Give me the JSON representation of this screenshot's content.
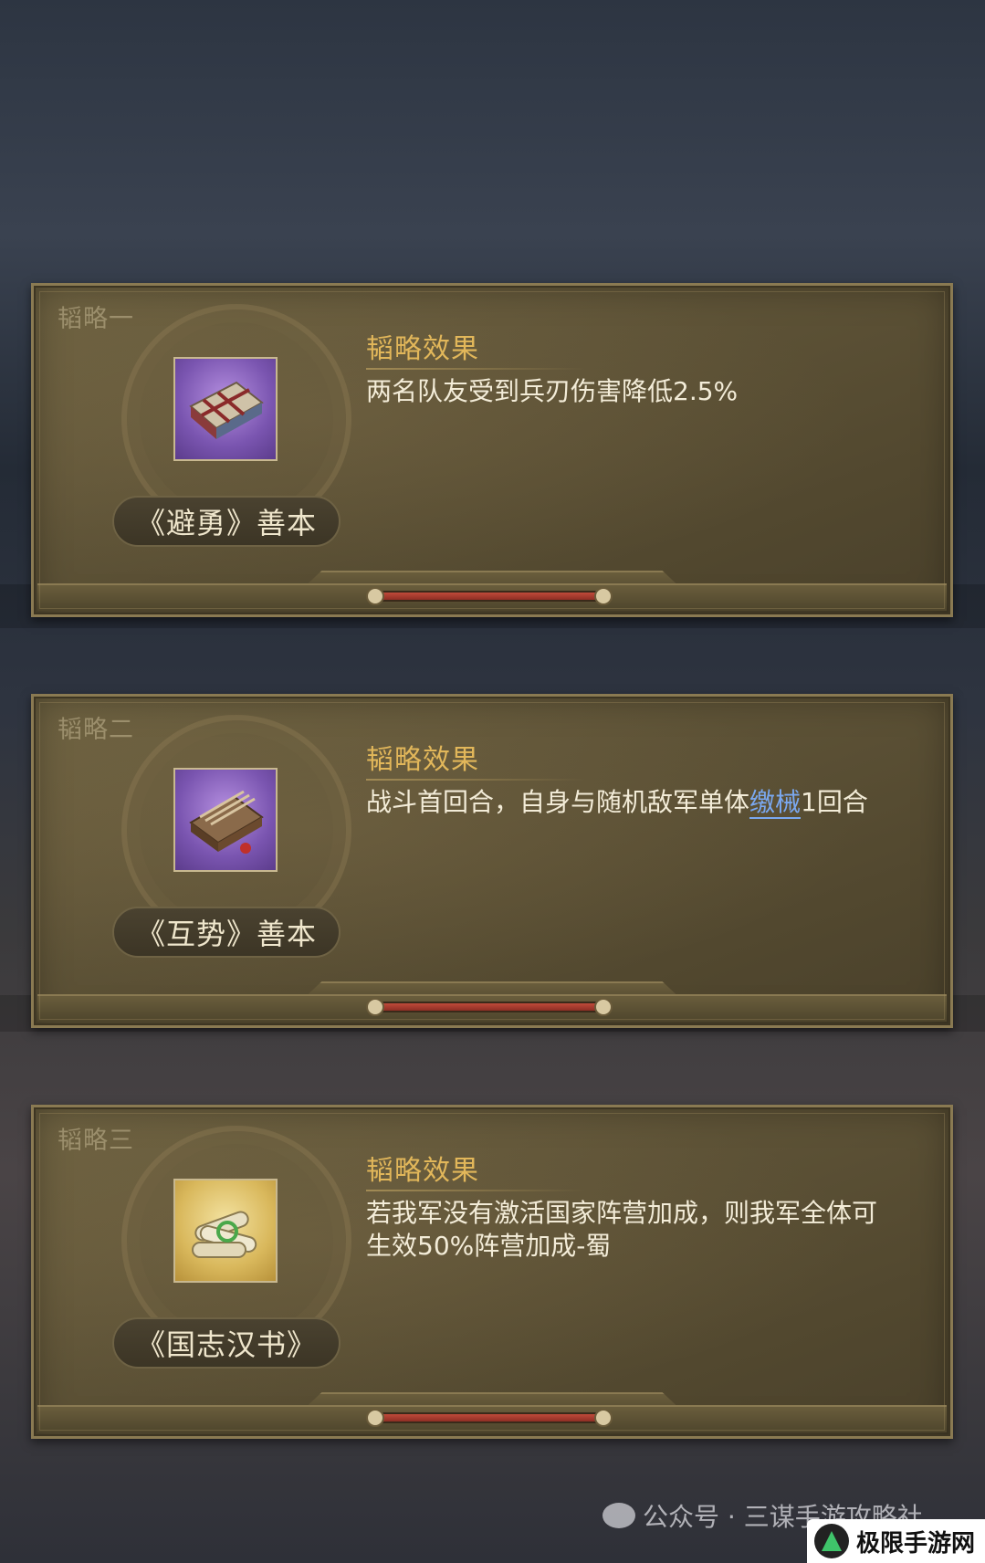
{
  "cards": [
    {
      "tag": "韬略一",
      "item_name": "《避勇》善本",
      "item_icon": "scroll-book-icon",
      "effect_title": "韬略效果",
      "effect_text": "两名队友受到兵刃伤害降低2.5%",
      "effect_link": ""
    },
    {
      "tag": "韬略二",
      "item_name": "《互势》善本",
      "item_icon": "bound-book-icon",
      "effect_title": "韬略效果",
      "effect_text_before": "战斗首回合，自身与随机敌军单体",
      "effect_link": "缴械",
      "effect_text_after": "1回合"
    },
    {
      "tag": "韬略三",
      "item_name": "《国志汉书》",
      "item_icon": "scroll-bundle-icon",
      "effect_title": "韬略效果",
      "effect_text": "若我军没有激活国家阵营加成，则我军全体可生效50%阵营加成-蜀"
    }
  ],
  "watermark": {
    "text": "公众号 · 三谋手游攻略社",
    "logo_text": "极限手游网"
  },
  "colors": {
    "panel": "#5e5337",
    "accent_gold": "#e2b75a",
    "link_blue": "#7aa8f0",
    "bar_red": "#c04a3a"
  }
}
